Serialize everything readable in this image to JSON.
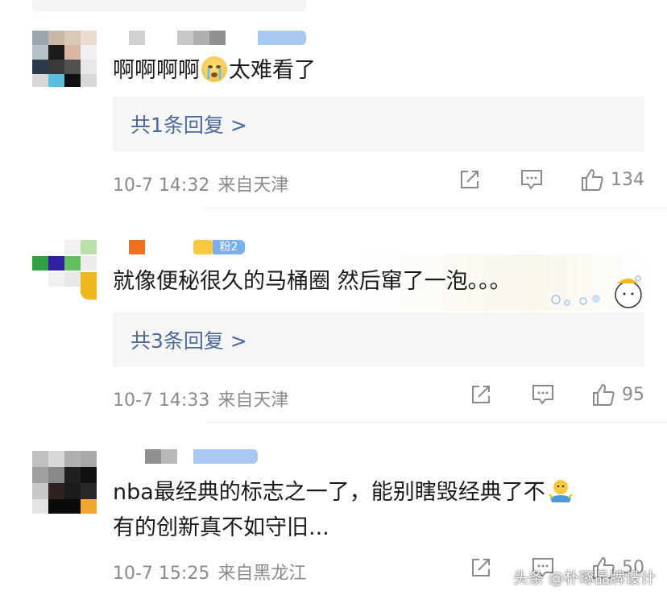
{
  "comments": [
    {
      "text": "啊啊啊啊",
      "text_after_emoji": "太难看了",
      "emoji": "crying-face",
      "reply_link": "共1条回复 >",
      "date": "10-7 14:32",
      "location": "来自天津",
      "likes": "134"
    },
    {
      "badge": "粉2",
      "text": "就像便秘很久的马桶圈 然后窜了一泡。。。",
      "reply_link": "共3条回复 >",
      "date": "10-7 14:33",
      "location": "来自天津",
      "likes": "95"
    },
    {
      "text_line1": "nba最经典的标志之一了，能别瞎毁经典了不",
      "emoji": "shrug-person",
      "text_line2": "有的创新真不如守旧...",
      "date": "10-7 15:25",
      "location": "来自黑龙江",
      "likes": "50"
    }
  ],
  "watermark": "头条 @朴琢品牌设计",
  "colors": {
    "reply_link": "#4a6a9a",
    "meta_text": "#8a8a8a",
    "reply_bg": "#f6f6f6"
  }
}
